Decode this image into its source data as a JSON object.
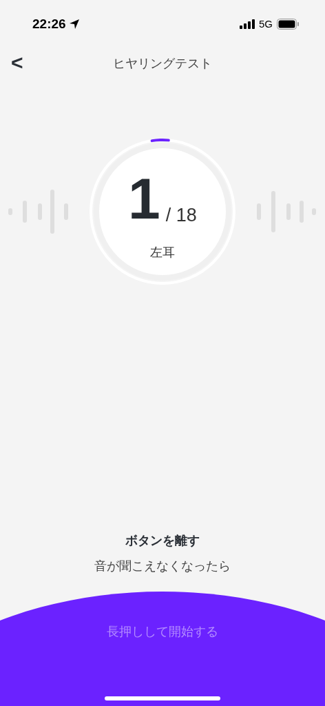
{
  "status_bar": {
    "time": "22:26",
    "network": "5G"
  },
  "header": {
    "back": "<",
    "title": "ヒヤリングテスト"
  },
  "counter": {
    "current": "1",
    "total": "/ 18",
    "ear": "左耳",
    "progress": {
      "level": 0.02
    }
  },
  "instruction": {
    "title": "ボタンを離す",
    "subtitle": "音が聞こえなくなったら"
  },
  "start_button": {
    "label": "長押しして開始する"
  }
}
